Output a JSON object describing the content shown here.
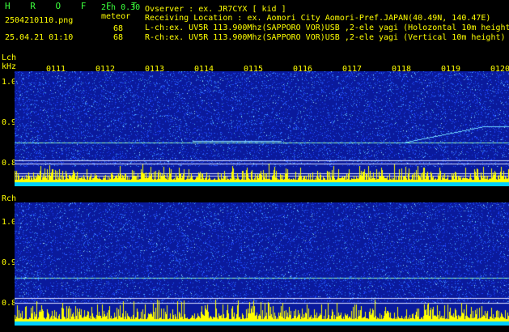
{
  "header": {
    "program": "H R O F F T",
    "mode": "2ch 0.30",
    "filename": "2504210110.png",
    "type": "meteor",
    "datetime": "25.04.21 01:10",
    "count_l": "68",
    "count_r": "68",
    "observer": "Ovserver              : ex. JR7CYX [ kid ]",
    "location": "Receiving Location : ex. Aomori City Aomori-Pref.JAPAN(40.49N, 140.47E)",
    "lch_info": "L-ch:ex. UV5R 113.900Mhz(SAPPORO VOR)USB ,2-ele yagi (Holozontal 10m height)",
    "rch_info": "R-ch:ex. UV5R 113.900Mhz(SAPPORO VOR)USB ,2-ele yagi (Vertical 10m height)"
  },
  "time_ticks": [
    "0111",
    "0112",
    "0113",
    "0114",
    "0115",
    "0116",
    "0117",
    "0118",
    "0119",
    "0120"
  ],
  "lch": {
    "label": "Lch",
    "unit": "kHz",
    "y_ticks": [
      "1.0",
      "0.9",
      "0.8"
    ]
  },
  "rch": {
    "label": "Rch",
    "y_ticks": [
      "1.0",
      "0.9",
      "0.8"
    ]
  },
  "colors": {
    "background": "#0a1fa8",
    "noise": "#1a3cff",
    "bars": "#ffff00",
    "base": "#00d8ff",
    "text_green": "#3cff3c",
    "text_yellow": "#ffff00"
  }
}
